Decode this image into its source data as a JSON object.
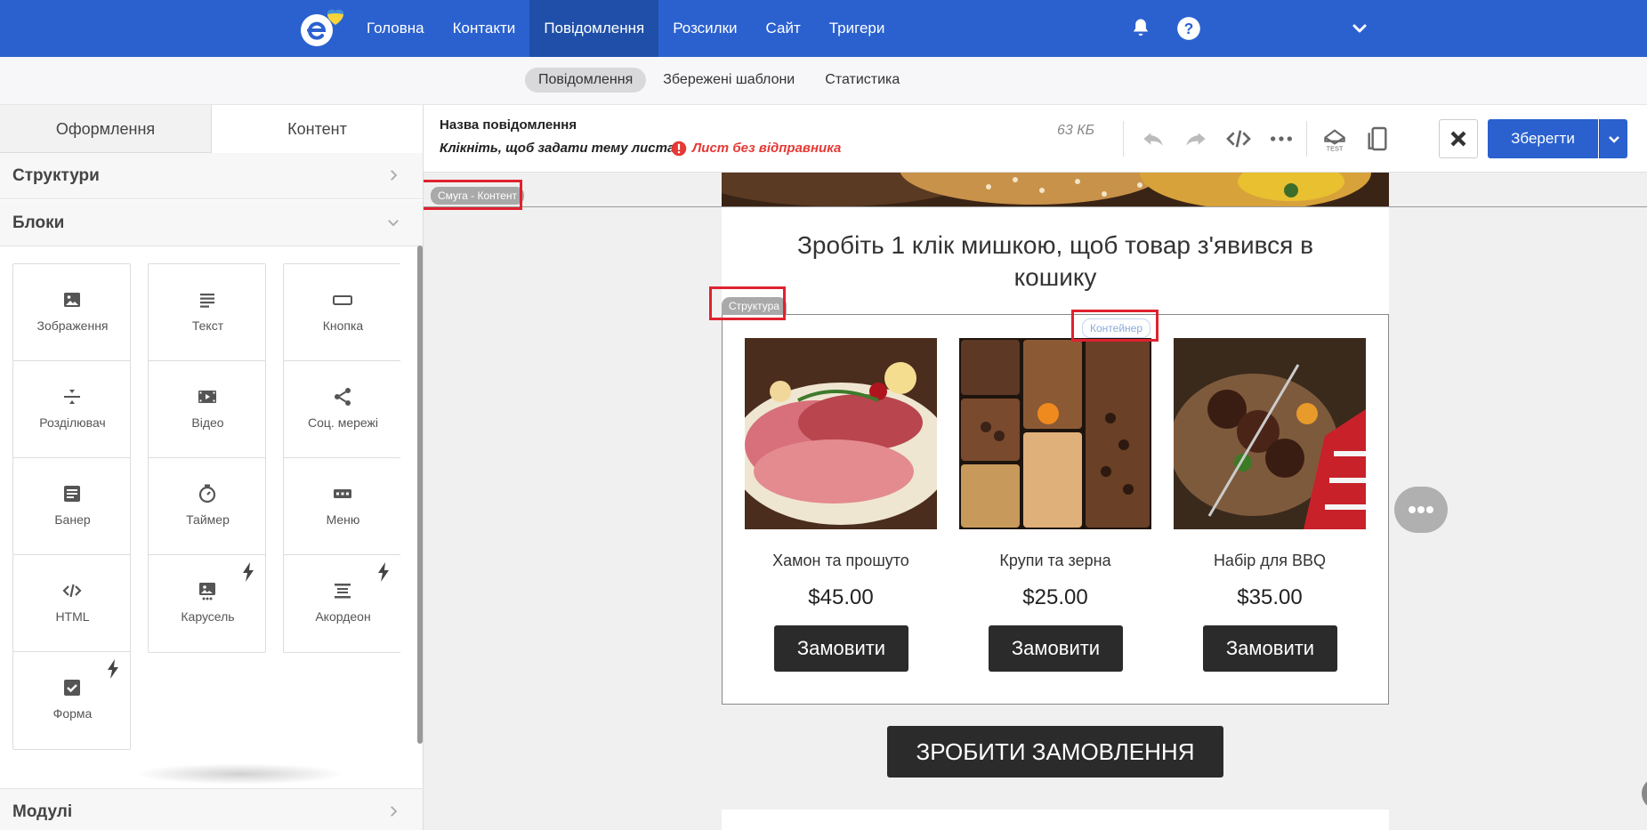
{
  "nav": {
    "items": [
      "Головна",
      "Контакти",
      "Повідомлення",
      "Розсилки",
      "Сайт",
      "Тригери"
    ],
    "active_index": 2
  },
  "subnav": {
    "items": [
      "Повідомлення",
      "Збережені шаблони",
      "Статистика"
    ],
    "active_index": 0
  },
  "left_panel": {
    "tabs": [
      "Оформлення",
      "Контент"
    ],
    "active_tab": 1,
    "sections": {
      "structures": "Структури",
      "blocks": "Блоки",
      "modules": "Модулі"
    },
    "blocks": [
      {
        "label": "Зображення",
        "icon": "image-icon",
        "premium": false
      },
      {
        "label": "Текст",
        "icon": "text-icon",
        "premium": false
      },
      {
        "label": "Кнопка",
        "icon": "button-icon",
        "premium": false
      },
      {
        "label": "Розділювач",
        "icon": "divider-icon",
        "premium": false
      },
      {
        "label": "Відео",
        "icon": "video-icon",
        "premium": false
      },
      {
        "label": "Соц. мережі",
        "icon": "share-icon",
        "premium": false
      },
      {
        "label": "Банер",
        "icon": "banner-icon",
        "premium": false
      },
      {
        "label": "Таймер",
        "icon": "timer-icon",
        "premium": false
      },
      {
        "label": "Меню",
        "icon": "menu-icon",
        "premium": false
      },
      {
        "label": "HTML",
        "icon": "code-icon",
        "premium": false
      },
      {
        "label": "Карусель",
        "icon": "carousel-icon",
        "premium": true
      },
      {
        "label": "Акордеон",
        "icon": "accordion-icon",
        "premium": true
      },
      {
        "label": "Форма",
        "icon": "form-icon",
        "premium": true
      }
    ]
  },
  "editor": {
    "message_title": "Назва повідомлення",
    "subject_prompt": "Клікніть, щоб задати тему листа",
    "sender_warning": "Лист без відправника",
    "size": "63 КБ",
    "save_label": "Зберегти"
  },
  "canvas": {
    "stripe_tag": "Смуга - Контент",
    "structure_tag": "Структура",
    "container_tag": "Контейнер",
    "headline": "Зробіть 1 клік мишкою, щоб товар з'явився в кошику",
    "products": [
      {
        "name": "Хамон та прошуто",
        "price": "$45.00",
        "button": "Замовити"
      },
      {
        "name": "Крупи та зерна",
        "price": "$25.00",
        "button": "Замовити"
      },
      {
        "name": "Набір для BBQ",
        "price": "$35.00",
        "button": "Замовити"
      }
    ],
    "order_button": "ЗРОБИТИ ЗАМОВЛЕННЯ"
  },
  "colors": {
    "brand": "#2b61cf",
    "warning": "#e53935",
    "highlight": "#e0222f",
    "dark_button": "#2b2b2b"
  }
}
